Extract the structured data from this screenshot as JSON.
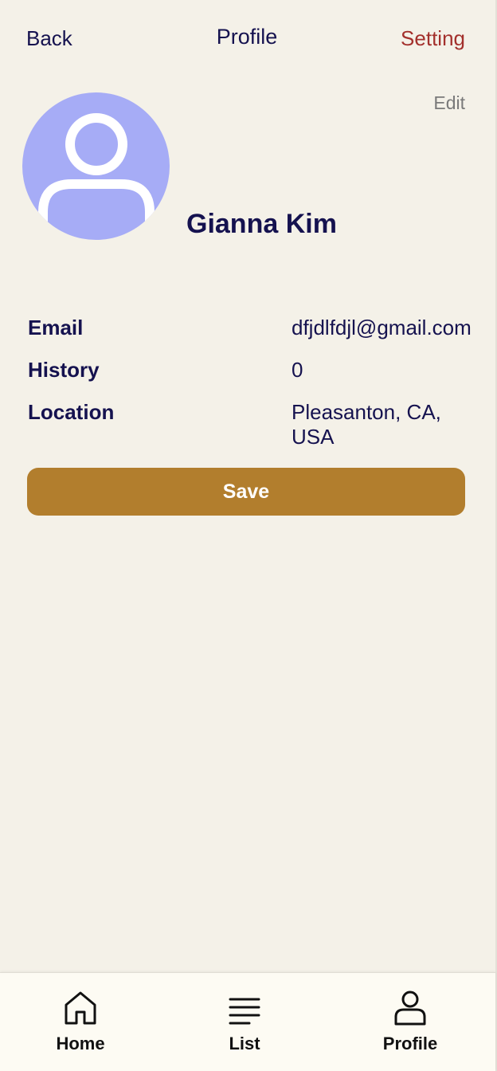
{
  "header": {
    "back_label": "Back",
    "title": "Profile",
    "setting_label": "Setting"
  },
  "profile": {
    "edit_label": "Edit",
    "name": "Gianna Kim",
    "avatar_icon": "user-avatar-icon"
  },
  "info": [
    {
      "label": "Email",
      "value": "dfjdlfdjl@gmail.com"
    },
    {
      "label": "History",
      "value": "0"
    },
    {
      "label": "Location",
      "value": "Pleasanton, CA, USA"
    }
  ],
  "save_label": "Save",
  "tabbar": {
    "items": [
      {
        "label": "Home",
        "icon": "home-icon"
      },
      {
        "label": "List",
        "icon": "list-icon"
      },
      {
        "label": "Profile",
        "icon": "profile-icon"
      }
    ]
  },
  "colors": {
    "background": "#f4f1e8",
    "text": "#15124f",
    "setting": "#a3302c",
    "edit": "#7a7a7a",
    "avatar": "#a6acf6",
    "save_button": "#b27e2d",
    "tabbar": "#fdfbf3"
  }
}
